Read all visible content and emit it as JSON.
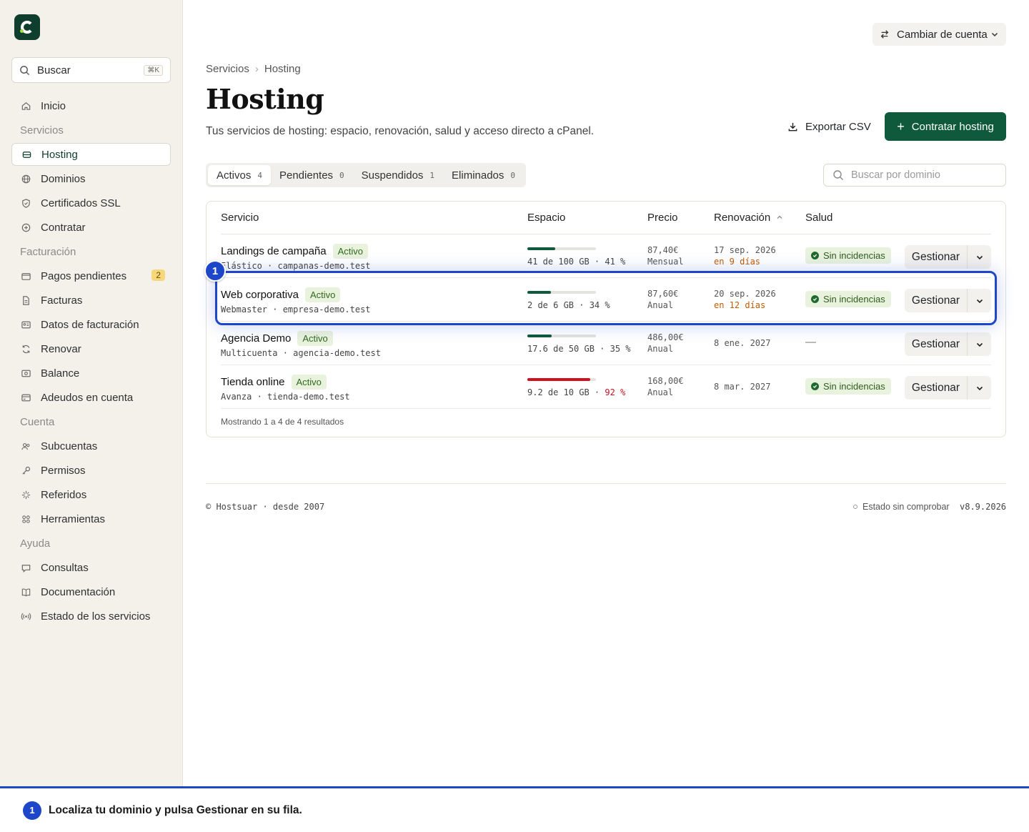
{
  "brand": {
    "color": "#0f3d2e",
    "accent": "#1e46c8",
    "primary": "#0f5a3d"
  },
  "sidebar": {
    "search": {
      "label": "Buscar",
      "shortcut": "⌘K"
    },
    "items": [
      {
        "type": "item",
        "label": "Inicio",
        "icon": "home-icon"
      },
      {
        "type": "section",
        "label": "Servicios"
      },
      {
        "type": "item",
        "label": "Hosting",
        "icon": "server-icon",
        "active": true
      },
      {
        "type": "item",
        "label": "Dominios",
        "icon": "globe-icon"
      },
      {
        "type": "item",
        "label": "Certificados SSL",
        "icon": "shield-icon"
      },
      {
        "type": "item",
        "label": "Contratar",
        "icon": "plus-circle-icon"
      },
      {
        "type": "section",
        "label": "Facturación"
      },
      {
        "type": "item",
        "label": "Pagos pendientes",
        "icon": "wallet-icon",
        "badge": "2"
      },
      {
        "type": "item",
        "label": "Facturas",
        "icon": "file-icon"
      },
      {
        "type": "item",
        "label": "Datos de facturación",
        "icon": "id-card-icon"
      },
      {
        "type": "item",
        "label": "Renovar",
        "icon": "refresh-icon"
      },
      {
        "type": "item",
        "label": "Balance",
        "icon": "balance-icon"
      },
      {
        "type": "item",
        "label": "Adeudos en cuenta",
        "icon": "credit-card-icon"
      },
      {
        "type": "section",
        "label": "Cuenta"
      },
      {
        "type": "item",
        "label": "Subcuentas",
        "icon": "users-icon"
      },
      {
        "type": "item",
        "label": "Permisos",
        "icon": "key-icon"
      },
      {
        "type": "item",
        "label": "Referidos",
        "icon": "sparkle-icon"
      },
      {
        "type": "item",
        "label": "Herramientas",
        "icon": "grid-icon"
      },
      {
        "type": "section",
        "label": "Ayuda"
      },
      {
        "type": "item",
        "label": "Consultas",
        "icon": "chat-icon"
      },
      {
        "type": "item",
        "label": "Documentación",
        "icon": "book-icon"
      },
      {
        "type": "item",
        "label": "Estado de los servicios",
        "icon": "broadcast-icon"
      }
    ]
  },
  "header": {
    "switch_account": "Cambiar de cuenta",
    "breadcrumb": [
      "Servicios",
      "Hosting"
    ],
    "title": "Hosting",
    "subtitle": "Tus servicios de hosting: espacio, renovación, salud y acceso directo a cPanel.",
    "export_label": "Exportar CSV",
    "primary_label": "Contratar hosting"
  },
  "tabs": [
    {
      "label": "Activos",
      "count": "4",
      "active": true
    },
    {
      "label": "Pendientes",
      "count": "0"
    },
    {
      "label": "Suspendidos",
      "count": "1"
    },
    {
      "label": "Eliminados",
      "count": "0"
    }
  ],
  "domain_search_placeholder": "Buscar por dominio",
  "table": {
    "headers": {
      "service": "Servicio",
      "space": "Espacio",
      "price": "Precio",
      "renewal": "Renovación",
      "health": "Salud"
    },
    "manage_label": "Gestionar",
    "rows": [
      {
        "name": "Landings de campaña",
        "status": "Activo",
        "sub": "Elástico · campanas-demo.test",
        "usage": 0.41,
        "space": "41 de 100 GB · ",
        "pct": "41 %",
        "pct_warn": false,
        "price": "87,40€",
        "period": "Mensual",
        "date": "17 sep. 2026",
        "soon": "en 9 días",
        "health": "Sin incidencias"
      },
      {
        "name": "Web corporativa",
        "status": "Activo",
        "sub": "Webmaster · empresa-demo.test",
        "usage": 0.34,
        "space": "2 de 6 GB · ",
        "pct": "34 %",
        "pct_warn": false,
        "price": "87,60€",
        "period": "Anual",
        "date": "20 sep. 2026",
        "soon": "en 12 días",
        "health": "Sin incidencias"
      },
      {
        "name": "Agencia Demo",
        "status": "Activo",
        "sub": "Multicuenta · agencia-demo.test",
        "usage": 0.35,
        "space": "17.6 de 50 GB · ",
        "pct": "35 %",
        "pct_warn": false,
        "price": "486,00€",
        "period": "Anual",
        "date": "8 ene. 2027",
        "soon": "",
        "health": "—"
      },
      {
        "name": "Tienda online",
        "status": "Activo",
        "sub": "Avanza · tienda-demo.test",
        "usage": 0.92,
        "space": "9.2 de 10 GB · ",
        "pct": "92 %",
        "pct_warn": true,
        "price": "168,00€",
        "period": "Anual",
        "date": "8 mar. 2027",
        "soon": "",
        "health": "Sin incidencias"
      }
    ],
    "footer": "Mostrando 1 a 4 de 4 resultados"
  },
  "footer": {
    "copyright": "© Hostsuar · desde 2007",
    "status": "Estado sin comprobar",
    "version": "v8.9.2026"
  },
  "tour": {
    "step": "1",
    "text": "Localiza tu dominio y pulsa Gestionar en su fila."
  }
}
